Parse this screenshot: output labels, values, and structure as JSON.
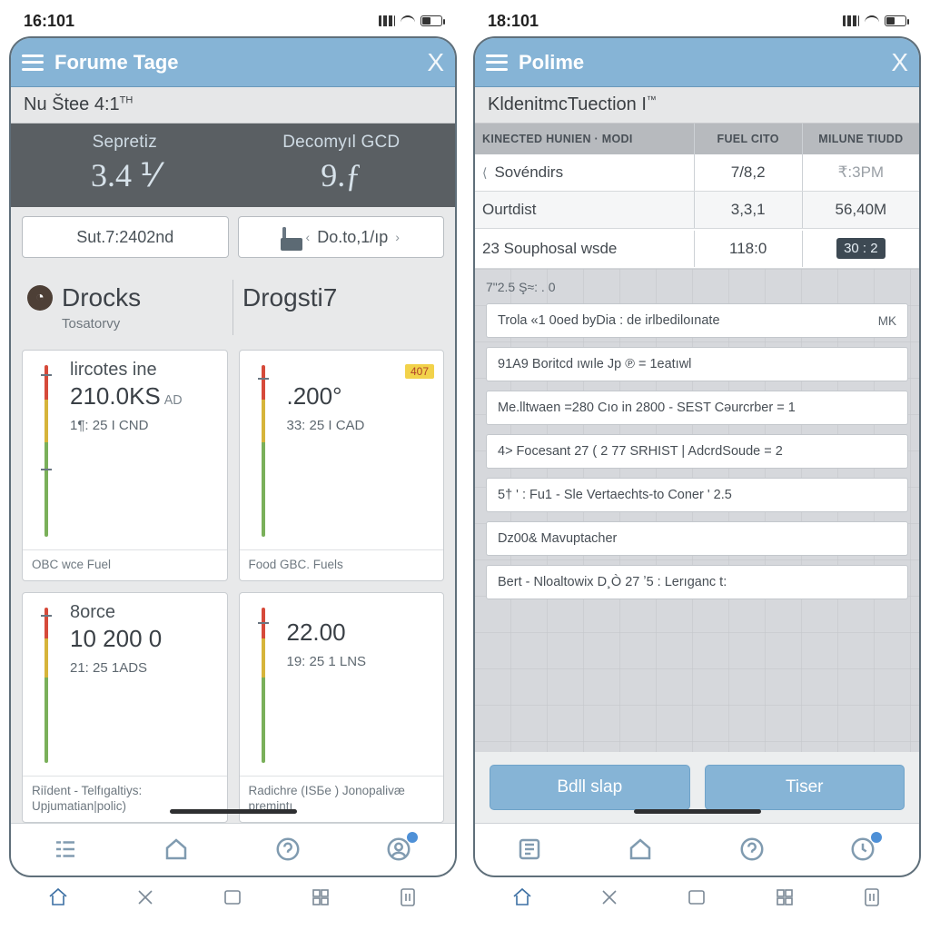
{
  "left": {
    "status_time": "16:101",
    "header_title": "Forume Tage",
    "subheader": "Nu Štee 4:1",
    "subheader_tm": "TH",
    "summary": {
      "left_label": "Sepretiz",
      "left_value": "3.4 ⅟",
      "right_label": "Decomyıl GCD",
      "right_value": "9.ƒ"
    },
    "pill1": "Sut.7:2402nd",
    "pill2": "Do.to,1/ıp",
    "cat_left_title": "Drocks",
    "cat_left_sub": "Tosatorvy",
    "cat_right_title": "Drogsti7",
    "cards": [
      {
        "t1": "lircotes ine",
        "t2": "210.0KS",
        "t2s": "AD",
        "t3": "1¶: 25  I CND",
        "foot": "OBC wce Fuel"
      },
      {
        "t1": "",
        "t2": ".200°",
        "t2s": "",
        "t3": "33: 25 I CAD",
        "foot": "Food GBC. Fuels",
        "tag": "407"
      },
      {
        "t1": "8orce",
        "t2": "10 200 0",
        "t2s": "",
        "t3": "21: 25 1ADS",
        "foot": "Riīdent - Telfıgaltiys: Upjumatian|polic)"
      },
      {
        "t1": "",
        "t2": "22.00",
        "t2s": "",
        "t3": "19: 25 1 LNS",
        "foot": "Radichre  (ISБe )  Jonopalivæ premintı"
      }
    ]
  },
  "right": {
    "status_time": "18:101",
    "header_title": "Polime",
    "subheader": "KldenitmcTuection I",
    "subheader_tm": "™",
    "table_headers": {
      "a": "KINECTED HUNIEN · MODI",
      "b": "FUEL CITO",
      "c": "MILUNE TIUDD"
    },
    "rows": [
      {
        "a_icon": "⟨",
        "a": "Sovéndirs",
        "b": "7/8,2",
        "c": "₹:3PM",
        "c_dim": true
      },
      {
        "a": "Ourtdist",
        "b": "3,3,1",
        "c": "56,40M"
      },
      {
        "a": "23 Souphosal wsde",
        "b": "118:0",
        "c_pill": "30 : 2"
      }
    ],
    "list_header": "7\"2.5                   Ş≈: .                0",
    "list_rows": [
      {
        "text": "Trola «1  0oed  byDia :   de  irlbediloınate",
        "trail": "MK"
      },
      {
        "text": "91A9  Boritcd            ıwıle Jp         ℗ = 1eatıwl"
      },
      {
        "text": "Me.lltwaen =280  Cıo  in 2800 -  SEST  Cəurcrber = 1"
      },
      {
        "text": "4>  Focesant  27 ( 2 77  SRHIST |  AdcrdSoude = 2"
      },
      {
        "text": "5† ' :  Fu1 - Sle  Vertaechts-to  Coner          ' 2.5"
      },
      {
        "text": "Dz00&  Mavuptacher"
      },
      {
        "text": "Bert - Nloaltowix     D¸Ò 27 ʼ5 :    Lerıganc t:"
      }
    ],
    "actions": {
      "primary": "Bdll slap",
      "secondary": "Tiser"
    }
  },
  "sysnav": [
    "home",
    "close",
    "recent",
    "grid",
    "digit"
  ]
}
